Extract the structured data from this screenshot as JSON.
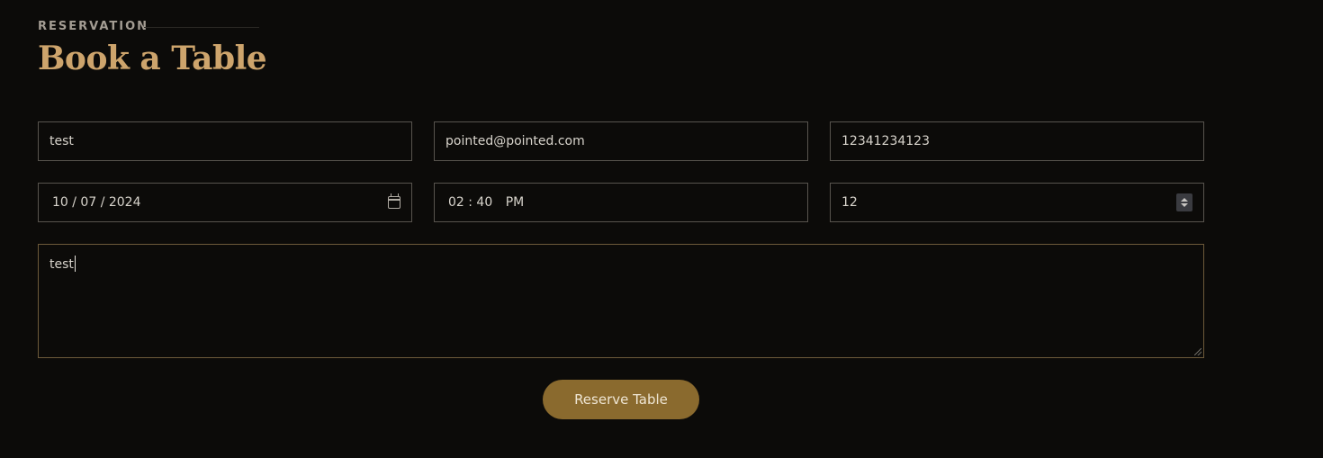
{
  "header": {
    "eyebrow": "RESERVATION",
    "title": "Book a Table"
  },
  "form": {
    "name": {
      "value": "test"
    },
    "email": {
      "value": "pointed@pointed.com"
    },
    "phone": {
      "value": "12341234123"
    },
    "date": {
      "value": "10 / 07 / 2024"
    },
    "time": {
      "value": "02 : 40",
      "period": "PM"
    },
    "people": {
      "value": "12"
    },
    "message": {
      "value": "test"
    },
    "submit_label": "Reserve Table"
  },
  "colors": {
    "background": "#0c0b09",
    "accent": "#cda46c",
    "button": "#8a6a2e"
  },
  "icons": {
    "date": "calendar-icon",
    "people": "spinner-icon"
  }
}
